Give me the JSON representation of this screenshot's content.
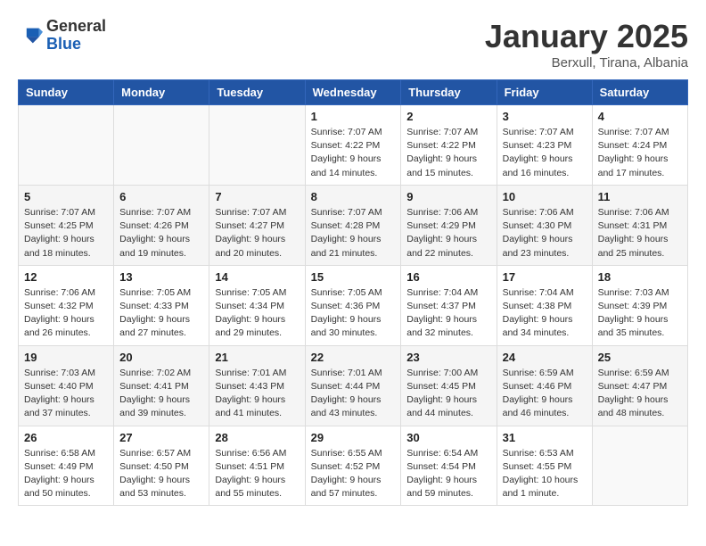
{
  "header": {
    "logo_general": "General",
    "logo_blue": "Blue",
    "month_title": "January 2025",
    "location": "Berxull, Tirana, Albania"
  },
  "weekdays": [
    "Sunday",
    "Monday",
    "Tuesday",
    "Wednesday",
    "Thursday",
    "Friday",
    "Saturday"
  ],
  "weeks": [
    [
      {
        "day": "",
        "info": ""
      },
      {
        "day": "",
        "info": ""
      },
      {
        "day": "",
        "info": ""
      },
      {
        "day": "1",
        "info": "Sunrise: 7:07 AM\nSunset: 4:22 PM\nDaylight: 9 hours\nand 14 minutes."
      },
      {
        "day": "2",
        "info": "Sunrise: 7:07 AM\nSunset: 4:22 PM\nDaylight: 9 hours\nand 15 minutes."
      },
      {
        "day": "3",
        "info": "Sunrise: 7:07 AM\nSunset: 4:23 PM\nDaylight: 9 hours\nand 16 minutes."
      },
      {
        "day": "4",
        "info": "Sunrise: 7:07 AM\nSunset: 4:24 PM\nDaylight: 9 hours\nand 17 minutes."
      }
    ],
    [
      {
        "day": "5",
        "info": "Sunrise: 7:07 AM\nSunset: 4:25 PM\nDaylight: 9 hours\nand 18 minutes."
      },
      {
        "day": "6",
        "info": "Sunrise: 7:07 AM\nSunset: 4:26 PM\nDaylight: 9 hours\nand 19 minutes."
      },
      {
        "day": "7",
        "info": "Sunrise: 7:07 AM\nSunset: 4:27 PM\nDaylight: 9 hours\nand 20 minutes."
      },
      {
        "day": "8",
        "info": "Sunrise: 7:07 AM\nSunset: 4:28 PM\nDaylight: 9 hours\nand 21 minutes."
      },
      {
        "day": "9",
        "info": "Sunrise: 7:06 AM\nSunset: 4:29 PM\nDaylight: 9 hours\nand 22 minutes."
      },
      {
        "day": "10",
        "info": "Sunrise: 7:06 AM\nSunset: 4:30 PM\nDaylight: 9 hours\nand 23 minutes."
      },
      {
        "day": "11",
        "info": "Sunrise: 7:06 AM\nSunset: 4:31 PM\nDaylight: 9 hours\nand 25 minutes."
      }
    ],
    [
      {
        "day": "12",
        "info": "Sunrise: 7:06 AM\nSunset: 4:32 PM\nDaylight: 9 hours\nand 26 minutes."
      },
      {
        "day": "13",
        "info": "Sunrise: 7:05 AM\nSunset: 4:33 PM\nDaylight: 9 hours\nand 27 minutes."
      },
      {
        "day": "14",
        "info": "Sunrise: 7:05 AM\nSunset: 4:34 PM\nDaylight: 9 hours\nand 29 minutes."
      },
      {
        "day": "15",
        "info": "Sunrise: 7:05 AM\nSunset: 4:36 PM\nDaylight: 9 hours\nand 30 minutes."
      },
      {
        "day": "16",
        "info": "Sunrise: 7:04 AM\nSunset: 4:37 PM\nDaylight: 9 hours\nand 32 minutes."
      },
      {
        "day": "17",
        "info": "Sunrise: 7:04 AM\nSunset: 4:38 PM\nDaylight: 9 hours\nand 34 minutes."
      },
      {
        "day": "18",
        "info": "Sunrise: 7:03 AM\nSunset: 4:39 PM\nDaylight: 9 hours\nand 35 minutes."
      }
    ],
    [
      {
        "day": "19",
        "info": "Sunrise: 7:03 AM\nSunset: 4:40 PM\nDaylight: 9 hours\nand 37 minutes."
      },
      {
        "day": "20",
        "info": "Sunrise: 7:02 AM\nSunset: 4:41 PM\nDaylight: 9 hours\nand 39 minutes."
      },
      {
        "day": "21",
        "info": "Sunrise: 7:01 AM\nSunset: 4:43 PM\nDaylight: 9 hours\nand 41 minutes."
      },
      {
        "day": "22",
        "info": "Sunrise: 7:01 AM\nSunset: 4:44 PM\nDaylight: 9 hours\nand 43 minutes."
      },
      {
        "day": "23",
        "info": "Sunrise: 7:00 AM\nSunset: 4:45 PM\nDaylight: 9 hours\nand 44 minutes."
      },
      {
        "day": "24",
        "info": "Sunrise: 6:59 AM\nSunset: 4:46 PM\nDaylight: 9 hours\nand 46 minutes."
      },
      {
        "day": "25",
        "info": "Sunrise: 6:59 AM\nSunset: 4:47 PM\nDaylight: 9 hours\nand 48 minutes."
      }
    ],
    [
      {
        "day": "26",
        "info": "Sunrise: 6:58 AM\nSunset: 4:49 PM\nDaylight: 9 hours\nand 50 minutes."
      },
      {
        "day": "27",
        "info": "Sunrise: 6:57 AM\nSunset: 4:50 PM\nDaylight: 9 hours\nand 53 minutes."
      },
      {
        "day": "28",
        "info": "Sunrise: 6:56 AM\nSunset: 4:51 PM\nDaylight: 9 hours\nand 55 minutes."
      },
      {
        "day": "29",
        "info": "Sunrise: 6:55 AM\nSunset: 4:52 PM\nDaylight: 9 hours\nand 57 minutes."
      },
      {
        "day": "30",
        "info": "Sunrise: 6:54 AM\nSunset: 4:54 PM\nDaylight: 9 hours\nand 59 minutes."
      },
      {
        "day": "31",
        "info": "Sunrise: 6:53 AM\nSunset: 4:55 PM\nDaylight: 10 hours\nand 1 minute."
      },
      {
        "day": "",
        "info": ""
      }
    ]
  ]
}
